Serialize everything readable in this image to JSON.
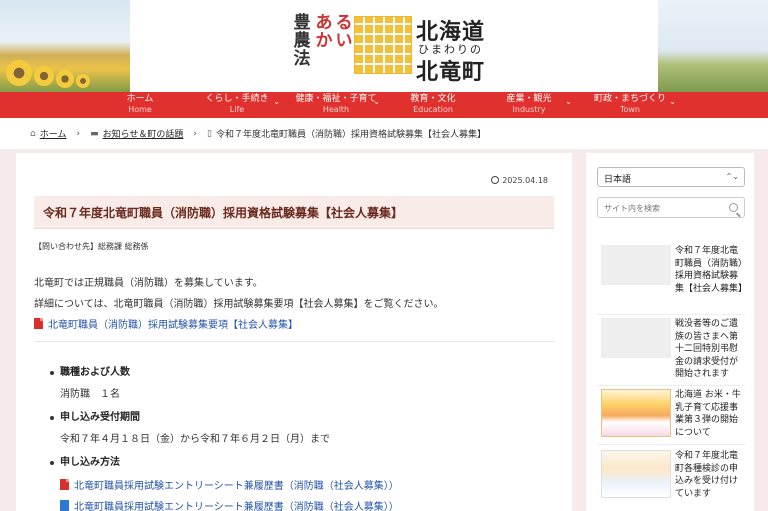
{
  "header": {
    "logo_vertical": [
      "豊",
      "農",
      "法",
      "あ",
      "か",
      "る",
      "い"
    ],
    "logo_line1": "北海道",
    "logo_line2": "ひまわりの",
    "logo_line3": "北竜町"
  },
  "nav": [
    {
      "jp": "ホーム",
      "en": "Home",
      "dropdown": false
    },
    {
      "jp": "くらし・手続き",
      "en": "Life",
      "dropdown": true
    },
    {
      "jp": "健康・福祉・子育て",
      "en": "Health",
      "dropdown": true
    },
    {
      "jp": "教育・文化",
      "en": "Education",
      "dropdown": false
    },
    {
      "jp": "産業・観光",
      "en": "Industry",
      "dropdown": true
    },
    {
      "jp": "町政・まちづくり",
      "en": "Town",
      "dropdown": true
    }
  ],
  "breadcrumb": {
    "home": "ホーム",
    "category": "お知らせ＆町の話題",
    "current": "令和７年度北竜町職員（消防職）採用資格試験募集【社会人募集】"
  },
  "article": {
    "date": "2025.04.18",
    "title": "令和７年度北竜町職員（消防職）採用資格試験募集【社会人募集】",
    "contact": "【問い合わせ先】総務課 総務係",
    "para1": "北竜町では正規職員（消防職）を募集しています。",
    "para2": "詳細については、北竜町職員（消防職）採用試験募集要項【社会人募集】をご覧ください。",
    "link": "北竜町職員（消防職）採用試験募集要項【社会人募集】",
    "items": [
      {
        "head": "職種および人数",
        "body": "消防職　１名"
      },
      {
        "head": "申し込み受付期間",
        "body": "令和７年４月１８日（金）から令和７年６月２日（月）まで"
      },
      {
        "head": "申し込み方法",
        "body": ""
      }
    ],
    "apply_links": [
      "北竜町職員採用試験エントリーシート兼履歴書（消防職（社会人募集））",
      "北竜町職員採用試験エントリーシート兼履歴書（消防職（社会人募集））"
    ]
  },
  "sidebar": {
    "language": "日本語",
    "search_placeholder": "サイト内を検索",
    "posts": [
      "令和７年度北竜町職員（消防職）採用資格試験募集【社会人募集】",
      "戦没者等のご遺族の皆さまへ第十二回特別弔慰金の請求受付が開始されます",
      "北海道 お米・牛乳子育て応援事業第３弾の開始について",
      "令和７年度北竜町各種検診の申込みを受け付けています"
    ]
  },
  "colors": {
    "nav_red": "#e0312e",
    "title_text": "#6a2a1e",
    "title_bg": "#f8ebe8",
    "link_blue": "#2454a8",
    "page_bg": "#f7eaea"
  }
}
